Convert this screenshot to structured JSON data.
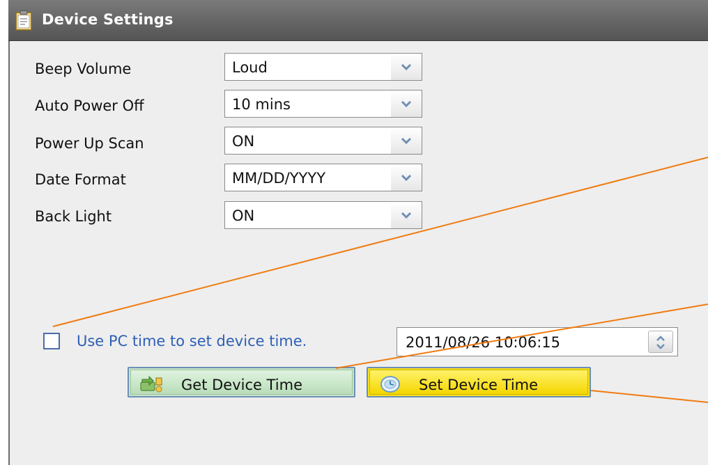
{
  "window": {
    "title": "Device Settings",
    "icon": "clipboard-icon"
  },
  "settings": [
    {
      "label": "Beep Volume",
      "value": "Loud"
    },
    {
      "label": "Auto Power Off",
      "value": "10 mins"
    },
    {
      "label": "Power Up Scan",
      "value": "ON"
    },
    {
      "label": "Date Format",
      "value": "MM/DD/YYYY"
    },
    {
      "label": "Back Light",
      "value": "ON"
    }
  ],
  "time_sync": {
    "checkbox_label": "Use PC time to set device time.",
    "checkbox_checked": false,
    "datetime_value": "2011/08/26 10:06:15"
  },
  "buttons": {
    "get_label": "Get Device Time",
    "set_label": "Set Device Time"
  },
  "colors": {
    "titlebar": "#5f5f5f",
    "panel": "#eeeeee",
    "label_blue": "#2d5fb5",
    "get_button": "#c8e5c8",
    "set_button": "#f7e11b",
    "callout_line": "#f07a10"
  }
}
